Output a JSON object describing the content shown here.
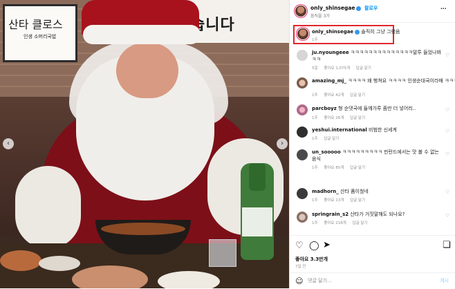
{
  "photo": {
    "banner_text": "습니다",
    "sign_title": "산타 클로스",
    "sign_sub": "인생 소머리국밥"
  },
  "header": {
    "username": "only_shinsegae",
    "subtitle": "움직을 3가",
    "follow_label": "팔로우",
    "more_label": "···"
  },
  "caption": {
    "username": "only_shinsegae",
    "text": "솔직히 그냥 그랬음",
    "time": "1주"
  },
  "comments": [
    {
      "user": "ju.nyoungeee",
      "text": "ㅋㅋㅋㅋㅋㅋㅋㅋㅋㅋㅋㅋㅋㅋ말투 들었나봐ㅋㅋ",
      "time": "5일",
      "likes": "좋아요 1,075개",
      "reply": "답글 달기"
    },
    {
      "user": "amazing_mj_",
      "text": "ㅋㅋㅋㅋ 왜 행쳐요 ㅋㅋㅋㅋ 인생순대국이라매 ㅋㅋㅋ",
      "time": "1주",
      "likes": "좋아요 42개",
      "reply": "답글 달기"
    },
    {
      "user": "parcboyz",
      "text": "형 순댓국에 들깨가루 좀만 더 넣어리..",
      "time": "1주",
      "likes": "좋아요 26개",
      "reply": "답글 달기"
    },
    {
      "user": "yeshui.international",
      "text": "비범한 신세계",
      "time": "1주",
      "likes": "",
      "reply": "답글 달기"
    },
    {
      "user": "un_sooooo",
      "text": "ㅋㅋㅋㅋㅋㅋㅋㅋㅋ 핀란드에서는 맛 볼 수 없는 음식",
      "time": "1주",
      "likes": "좋아요 85개",
      "reply": "답글 달기"
    },
    {
      "user": "madhorn_",
      "text": "산타 퓸이쳤네",
      "time": "1주",
      "likes": "좋아요 13개",
      "reply": "답글 달기"
    },
    {
      "user": "springrain_s2",
      "text": "산타가 거짓말해도 되나요?",
      "time": "1주",
      "likes": "좋아요 218개",
      "reply": "답글 달기"
    }
  ],
  "footer": {
    "likes": "좋아요 3.3만개",
    "date": "7일 전",
    "add_placeholder": "댓글 달기...",
    "post_label": "게시"
  }
}
